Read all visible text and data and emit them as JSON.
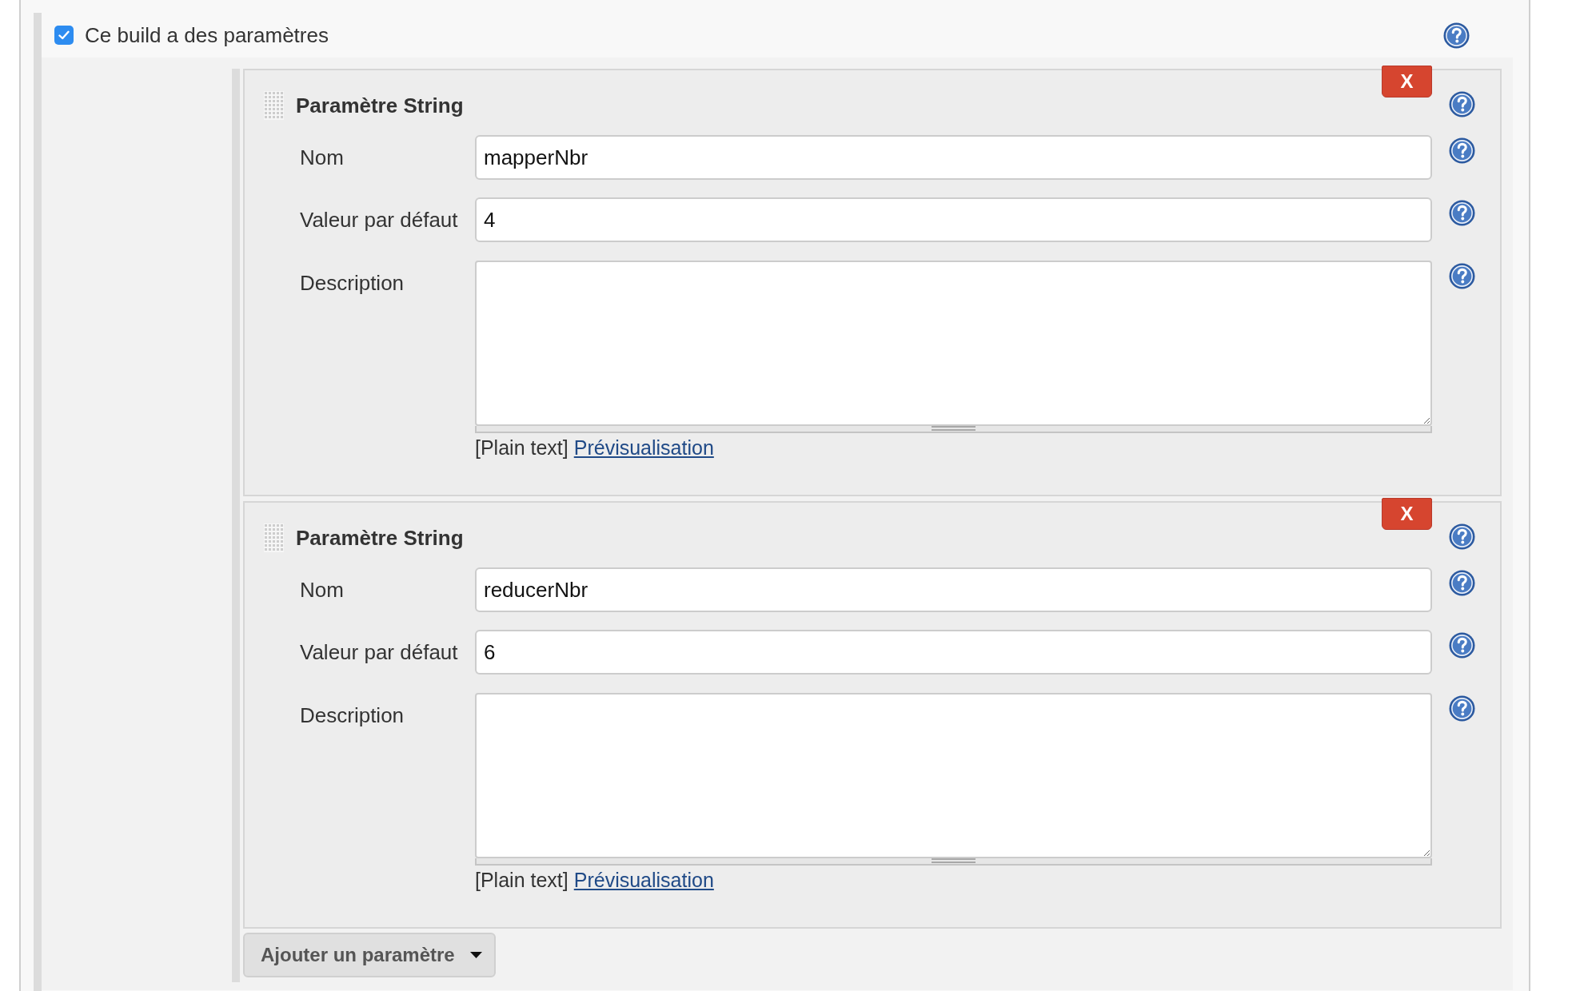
{
  "build_parameters": {
    "label": "Ce build a des paramètres",
    "checked": true
  },
  "parameters": [
    {
      "title": "Paramètre String",
      "remove": "X",
      "fields": [
        {
          "kind": "text",
          "label": "Nom",
          "value": "mapperNbr"
        },
        {
          "kind": "text",
          "label": "Valeur par défaut",
          "value": "4"
        },
        {
          "kind": "textarea",
          "label": "Description"
        }
      ],
      "format": "[Plain text]",
      "preview_link": "Prévisualisation"
    },
    {
      "title": "Paramètre String",
      "remove": "X",
      "fields": [
        {
          "kind": "text",
          "label": "Nom",
          "value": "reducerNbr"
        },
        {
          "kind": "text",
          "label": "Valeur par défaut",
          "value": "6"
        },
        {
          "kind": "textarea",
          "label": "Description"
        }
      ],
      "format": "[Plain text]",
      "preview_link": "Prévisualisation"
    }
  ],
  "add_button": {
    "label": "Ajouter un paramètre"
  }
}
